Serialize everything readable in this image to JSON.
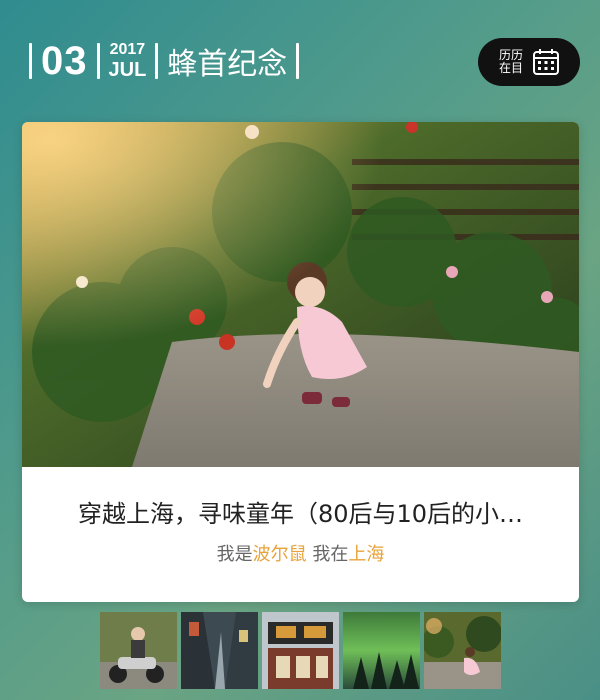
{
  "header": {
    "day": "03",
    "year": "2017",
    "month": "JUL",
    "title": "蜂首纪念"
  },
  "calendar_button": {
    "label_line1": "历历",
    "label_line2": "在目",
    "icon": "calendar-icon"
  },
  "card": {
    "title": "穿越上海，寻味童年（80后与10后的小…",
    "meta_prefix": "我是",
    "author": "波尔鼠",
    "meta_middle": "我在",
    "location": "上海",
    "highlight_color": "#e8a33a"
  },
  "thumbnails": [
    {
      "subject": "scooter-rider"
    },
    {
      "subject": "old-alley"
    },
    {
      "subject": "shopfront"
    },
    {
      "subject": "aurora-forest"
    },
    {
      "subject": "child-in-garden"
    }
  ]
}
